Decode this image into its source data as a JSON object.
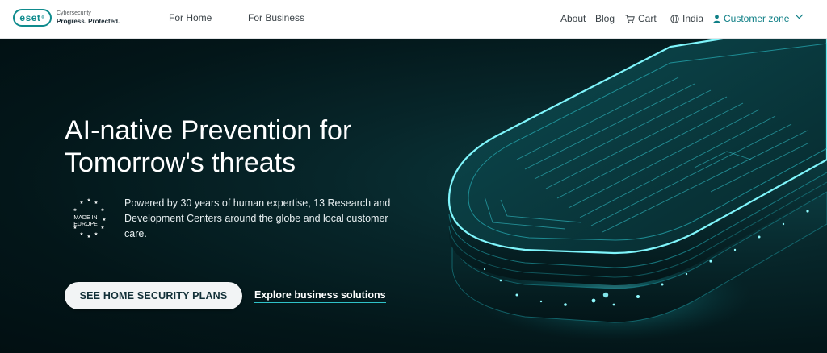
{
  "brand": {
    "logo_text": "eset",
    "logo_small": "Cybersecurity",
    "tagline": "Progress. Protected."
  },
  "nav": {
    "for_home": "For Home",
    "for_business": "For Business"
  },
  "utility": {
    "about": "About",
    "blog": "Blog",
    "cart": "Cart",
    "region": "India",
    "customer_zone": "Customer zone"
  },
  "hero": {
    "title": "AI-native Prevention for Tomorrow's threats",
    "badge_line1": "MADE IN",
    "badge_line2": "EUROPE",
    "description": "Powered by 30 years of human expertise, 13 Research and Development Centers around the globe and local customer care.",
    "primary_button": "SEE HOME SECURITY PLANS",
    "secondary_link": "Explore business solutions"
  },
  "colors": {
    "accent": "#0f8b8d",
    "customer_zone": "#0f7f86",
    "hero_bg": "#031619",
    "link_underline": "#2fc2c8"
  },
  "icons": {
    "cart": "cart-icon",
    "region": "globe-icon",
    "customer": "user-icon",
    "dropdown": "chevron-down-icon"
  }
}
